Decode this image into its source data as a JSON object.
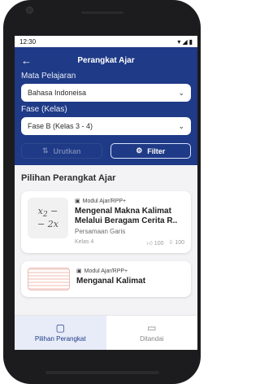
{
  "status": {
    "time": "12:30",
    "icons": [
      "wifi-icon",
      "signal-icon",
      "battery-icon"
    ]
  },
  "header": {
    "title": "Perangkat Ajar",
    "subject_label": "Mata Pelajaran",
    "subject_value": "Bahasa Indoneisa",
    "phase_label": "Fase (Kelas)",
    "phase_value": "Fase B (Kelas 3 - 4)",
    "sort_label": "Urutkan",
    "filter_label": "Filter"
  },
  "section": {
    "title": "Pilihan Perangkat Ajar"
  },
  "cards": [
    {
      "type": "Modul Ajar/RPP+",
      "title": "Mengenal Makna Kalimat Melalui Beragam Cerita R..",
      "subtitle": "Persamaan Garis",
      "grade": "Kelas 4",
      "likes": "100",
      "downloads": "100"
    },
    {
      "type": "Modul Ajar/RPP+",
      "title": "Menganal Kalimat"
    }
  ],
  "bottom_nav": {
    "items": [
      {
        "label": "Pilihan Perangkat"
      },
      {
        "label": "Ditandai"
      }
    ]
  },
  "colors": {
    "primary": "#1f3a86",
    "nav_active_bg": "#e8ecf8"
  }
}
